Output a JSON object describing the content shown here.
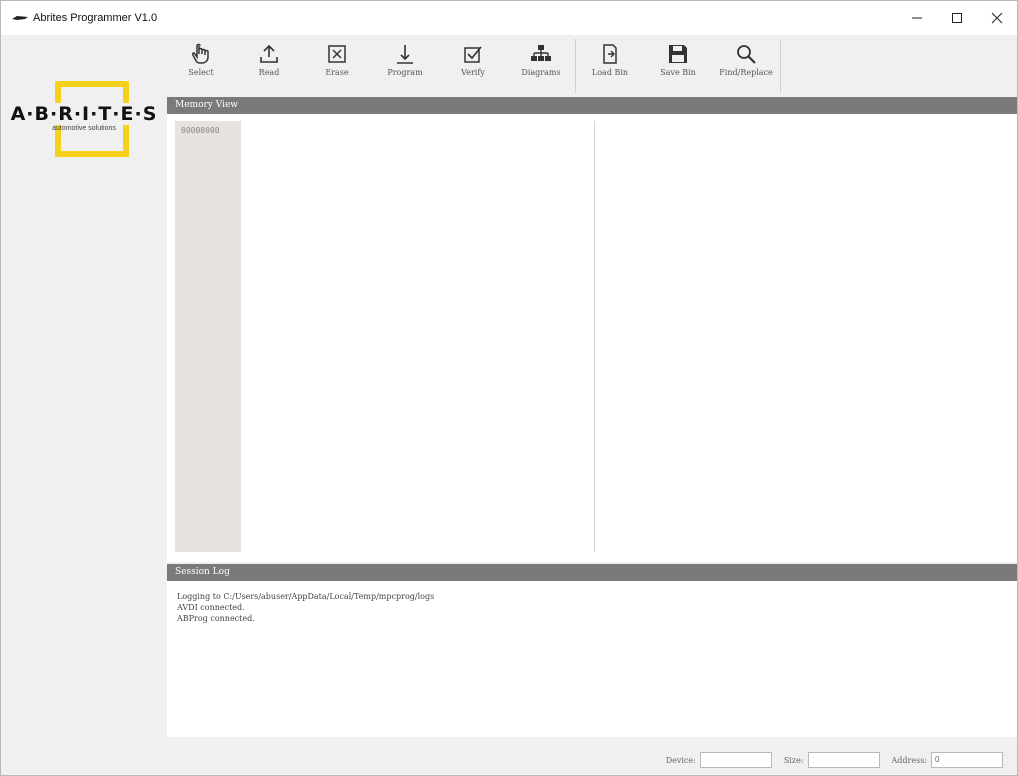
{
  "window": {
    "title": "Abrites Programmer V1.0",
    "controls": {
      "minimize": "—",
      "maximize": "☐",
      "close": "✕"
    }
  },
  "logo": {
    "brand": "A·B·R·I·T·E·S",
    "tagline": "automotive solutions",
    "accent_color": "#f5d11c"
  },
  "toolbar": {
    "items": [
      {
        "label": "Select",
        "icon": "hand-pointer-icon"
      },
      {
        "label": "Read",
        "icon": "upload-icon"
      },
      {
        "label": "Erase",
        "icon": "erase-box-icon"
      },
      {
        "label": "Program",
        "icon": "download-arrow-icon"
      },
      {
        "label": "Verify",
        "icon": "checkbox-icon"
      },
      {
        "label": "Diagrams",
        "icon": "hierarchy-icon"
      },
      {
        "label": "Load Bin",
        "icon": "load-file-icon"
      },
      {
        "label": "Save Bin",
        "icon": "floppy-disk-icon"
      },
      {
        "label": "Find/Replace",
        "icon": "magnifier-icon"
      }
    ]
  },
  "memory_view": {
    "header": "Memory View",
    "first_address": "00000000"
  },
  "session_log": {
    "header": "Session Log",
    "lines": [
      "Logging to C:/Users/abuser/AppData/Local/Temp/mpcprog/logs",
      "AVDI connected.",
      "ABProg connected."
    ]
  },
  "status": {
    "device_label": "Device:",
    "device_value": "",
    "size_label": "Size:",
    "size_value": "",
    "address_label": "Address:",
    "address_value": "0"
  },
  "colors": {
    "header_bg": "#7a7a7a",
    "window_bg": "#f0f0f0",
    "address_column_bg": "#e6e2dd"
  }
}
